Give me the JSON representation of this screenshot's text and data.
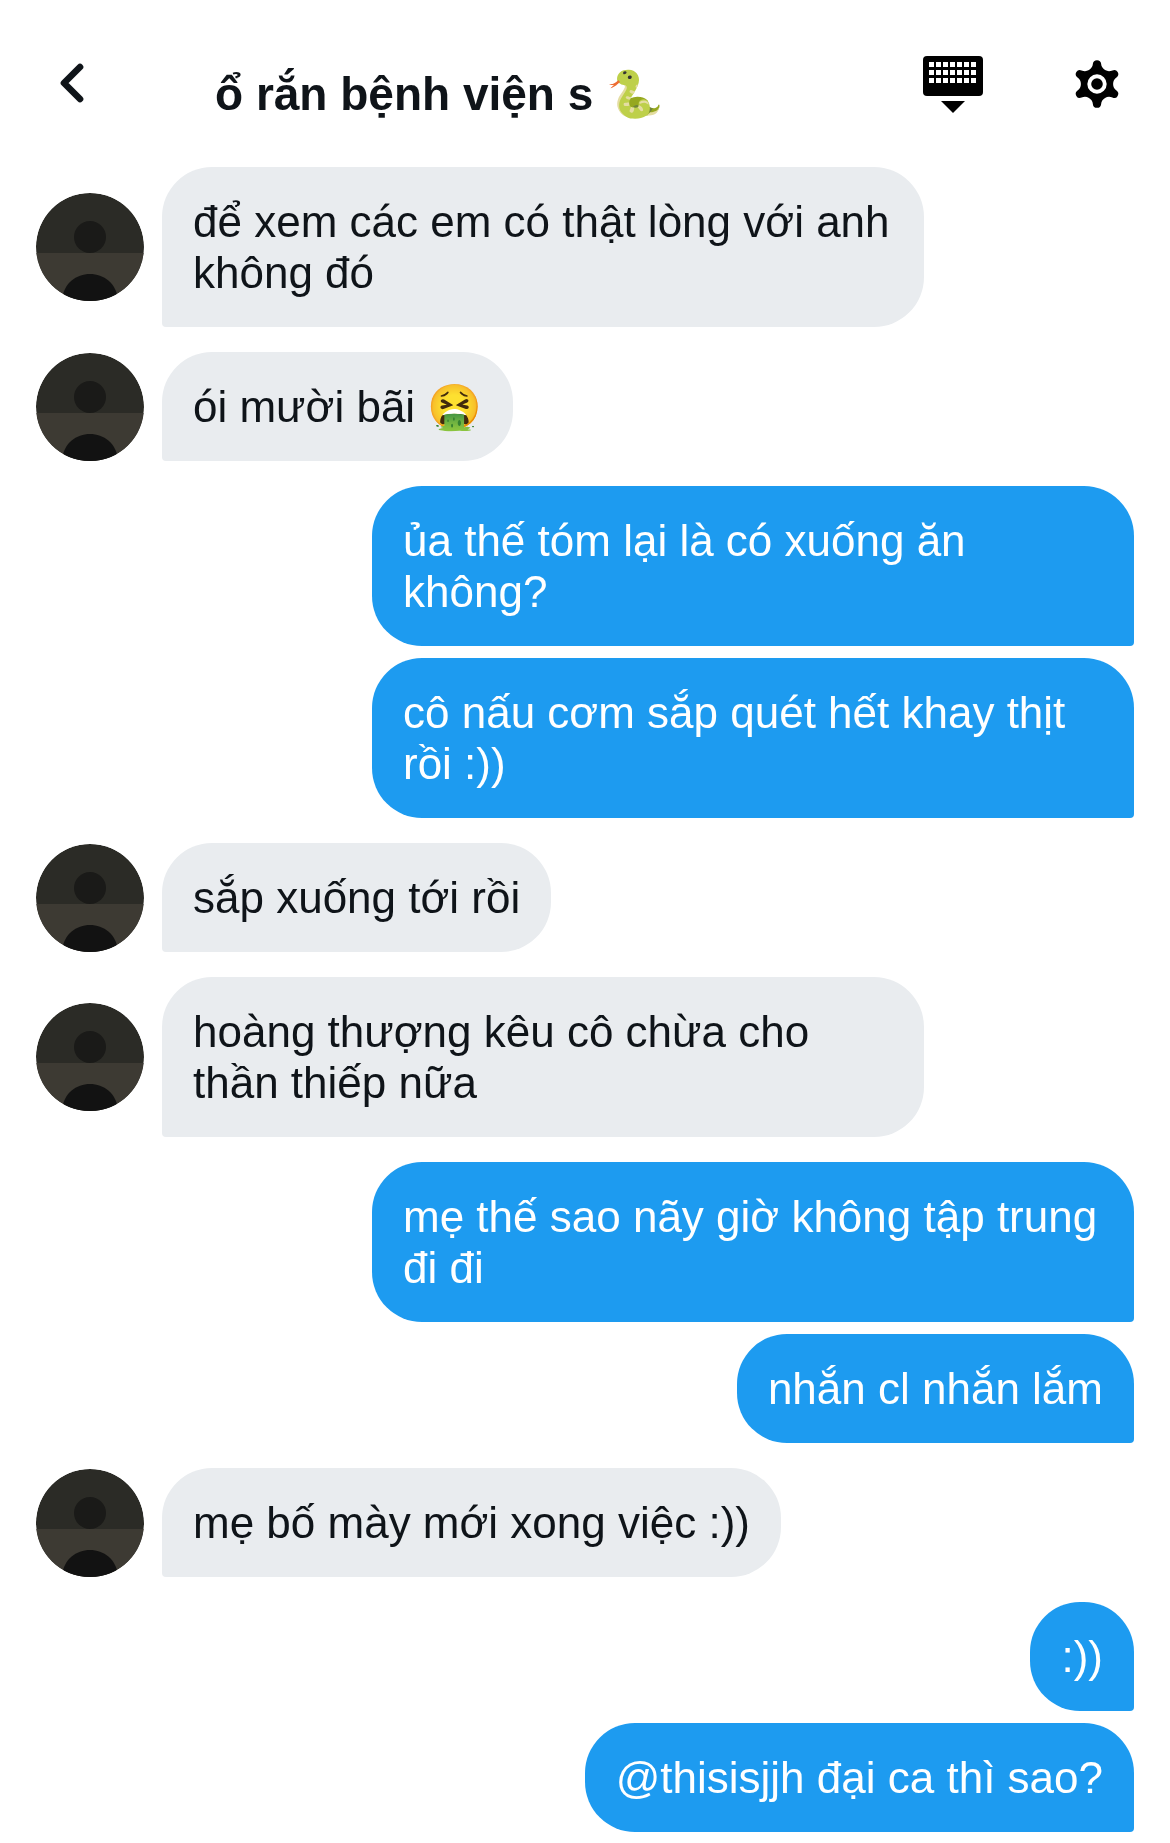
{
  "header": {
    "title": "ổ rắn bệnh viện s 🐍"
  },
  "messages": [
    {
      "kind": "received",
      "text": "để xem các em có thật lòng với anh không đó"
    },
    {
      "kind": "received",
      "text": "ói mười bãi 🤮"
    },
    {
      "kind": "sent",
      "text": "ủa thế tóm lại là có xuống ăn không?"
    },
    {
      "kind": "sent",
      "text": "cô nấu cơm sắp quét hết khay thịt rồi :))"
    },
    {
      "kind": "received",
      "text": "sắp xuống tới rồi"
    },
    {
      "kind": "received",
      "text": "hoàng thượng kêu cô chừa cho thần thiếp nữa"
    },
    {
      "kind": "sent",
      "text": "mẹ thế sao nãy giờ không tập trung đi đi"
    },
    {
      "kind": "sent",
      "text": "nhắn cl nhắn lắm"
    },
    {
      "kind": "received",
      "text": "mẹ bố mày mới xong việc :))"
    },
    {
      "kind": "sent",
      "text": ":))"
    },
    {
      "kind": "sent",
      "text": "@thisisjjh đại ca thì sao?"
    }
  ]
}
